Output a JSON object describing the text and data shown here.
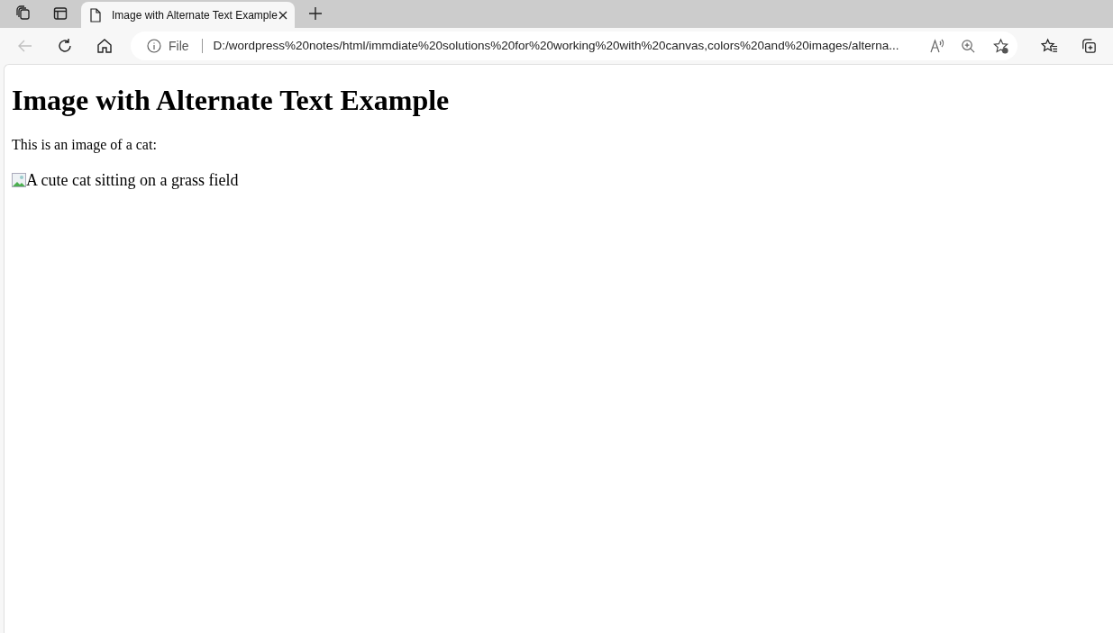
{
  "tabs": [
    {
      "title": "Image with Alternate Text Example",
      "selected": true
    }
  ],
  "toolbar": {
    "back_disabled": true,
    "scheme": "File",
    "url": "D:/wordpress%20notes/html/immdiate%20solutions%20for%20working%20with%20canvas,colors%20and%20images/alterna..."
  },
  "page": {
    "heading": "Image with Alternate Text Example",
    "paragraph": "This is an image of a cat:",
    "image_alt": "A cute cat sitting on a grass field"
  }
}
